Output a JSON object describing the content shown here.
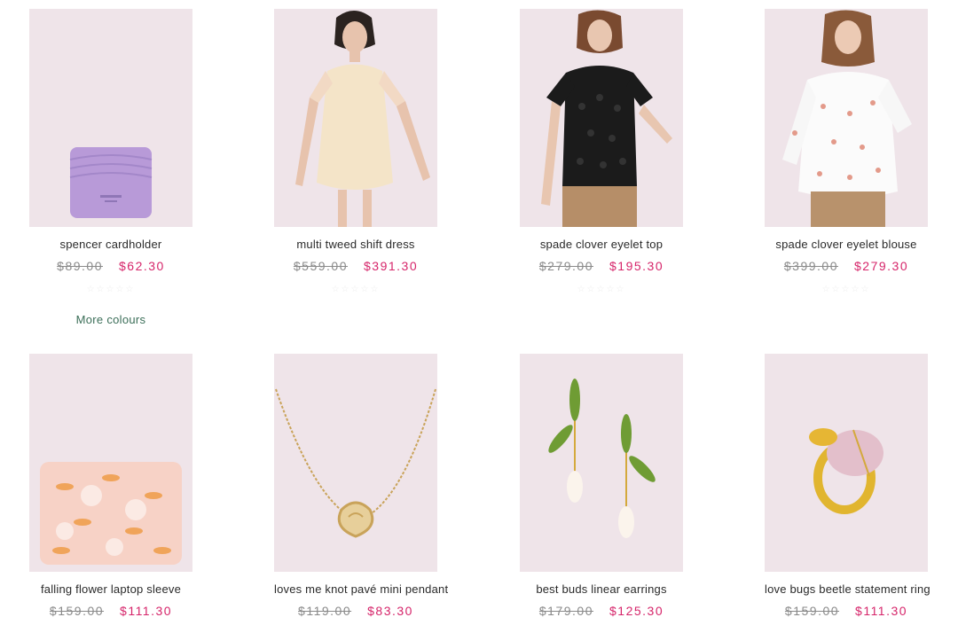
{
  "products": [
    {
      "name": "spencer cardholder",
      "original_price": "$89.00",
      "sale_price": "$62.30",
      "rating": "☆☆☆☆☆",
      "more_colours": "More colours",
      "image": "lilac-cardholder"
    },
    {
      "name": "multi tweed shift dress",
      "original_price": "$559.00",
      "sale_price": "$391.30",
      "rating": "☆☆☆☆☆",
      "image": "model-tweed-dress"
    },
    {
      "name": "spade clover eyelet top",
      "original_price": "$279.00",
      "sale_price": "$195.30",
      "rating": "☆☆☆☆☆",
      "image": "model-black-eyelet-top"
    },
    {
      "name": "spade clover eyelet blouse",
      "original_price": "$399.00",
      "sale_price": "$279.30",
      "rating": "☆☆☆☆☆",
      "image": "model-white-eyelet-blouse"
    },
    {
      "name": "falling flower laptop sleeve",
      "original_price": "$159.00",
      "sale_price": "$111.30",
      "image": "floral-laptop-sleeve"
    },
    {
      "name": "loves me knot pavé mini pendant",
      "original_price": "$119.00",
      "sale_price": "$83.30",
      "image": "gold-knot-pendant"
    },
    {
      "name": "best buds linear earrings",
      "original_price": "$179.00",
      "sale_price": "$125.30",
      "image": "bud-earrings"
    },
    {
      "name": "love bugs beetle statement ring",
      "original_price": "$159.00",
      "sale_price": "$111.30",
      "image": "beetle-ring"
    }
  ],
  "colors": {
    "sale": "#d6256a",
    "original": "#8a8a8a",
    "more_link": "#3b6e58",
    "image_bg": "#f0e6ea"
  }
}
